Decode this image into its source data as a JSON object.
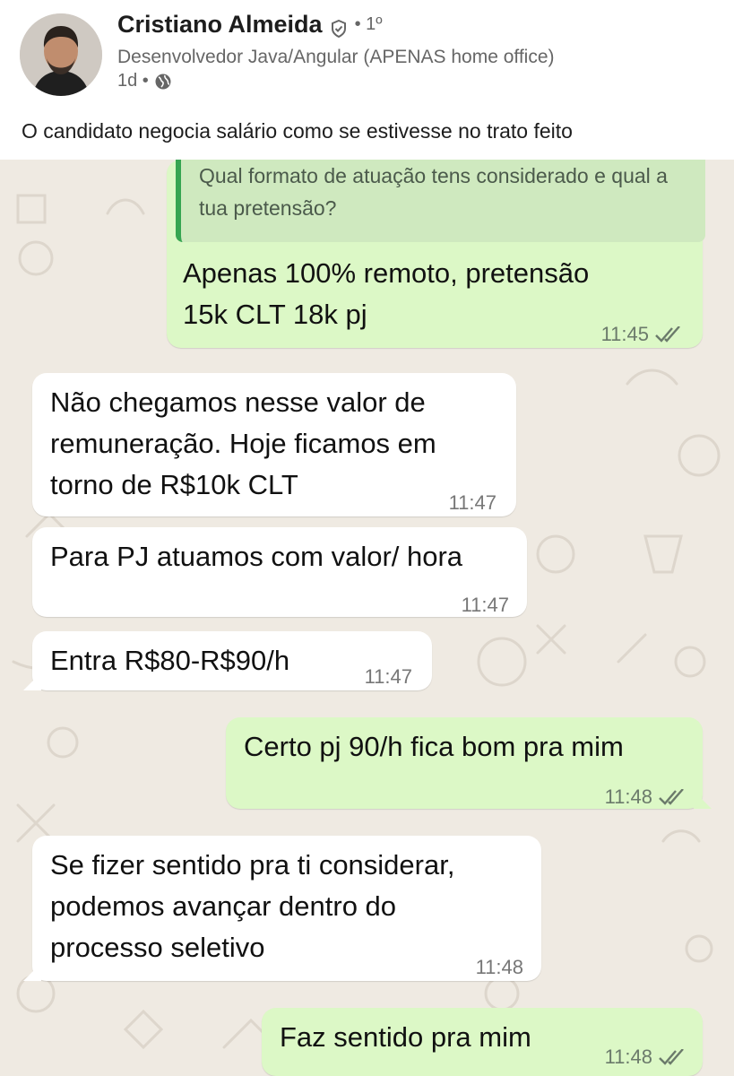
{
  "post": {
    "author": "Cristiano Almeida",
    "degree": "• 1º",
    "headline": "Desenvolvedor Java/Angular (APENAS home office)",
    "time": "1d •",
    "text": "O candidato negocia salário como se estivesse no trato feito"
  },
  "chat": {
    "quoted": "Qual formato de atuação tens considerado e qual a tua pretensão?",
    "messages": [
      {
        "dir": "out",
        "lines": [
          "Apenas 100% remoto, pretensão",
          "15k CLT 18k pj"
        ],
        "time": "11:45"
      },
      {
        "dir": "in",
        "lines": [
          "Não chegamos nesse valor de",
          "remuneração. Hoje ficamos em",
          "torno de R$10k CLT"
        ],
        "time": "11:47"
      },
      {
        "dir": "in",
        "lines": [
          "Para PJ atuamos com valor/ hora"
        ],
        "time": "11:47"
      },
      {
        "dir": "in",
        "lines": [
          "Entra R$80-R$90/h"
        ],
        "time": "11:47"
      },
      {
        "dir": "out",
        "lines": [
          "Certo pj 90/h fica bom pra mim"
        ],
        "time": "11:48"
      },
      {
        "dir": "in",
        "lines": [
          "Se fizer sentido pra ti considerar,",
          "podemos avançar dentro do",
          "processo seletivo"
        ],
        "time": "11:48"
      },
      {
        "dir": "out",
        "lines": [
          "Faz sentido pra mim"
        ],
        "time": "11:48"
      }
    ]
  },
  "icons": {
    "verified": "verified-badge-icon",
    "visibility": "globe-icon",
    "read_receipt": "double-check-icon"
  },
  "colors": {
    "chat_bg": "#efeae2",
    "outgoing": "#dcf8c6",
    "incoming": "#ffffff",
    "quote_bar": "#36a551"
  }
}
